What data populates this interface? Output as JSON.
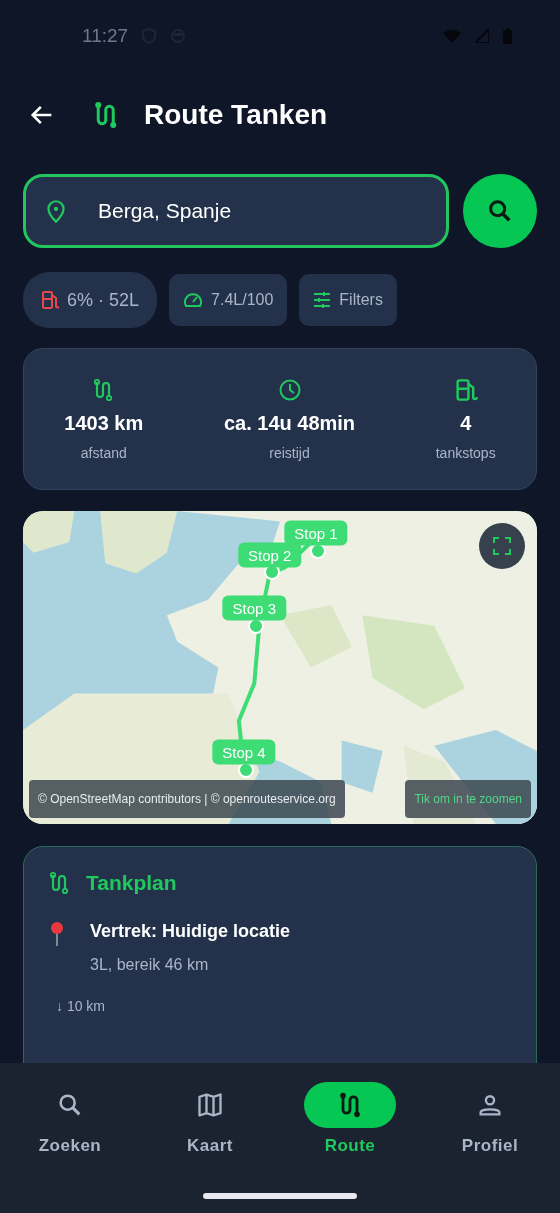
{
  "status_bar": {
    "time": "11:27"
  },
  "header": {
    "title": "Route Tanken"
  },
  "search": {
    "value": "Berga, Spanje"
  },
  "chips": [
    {
      "kind": "fuel",
      "label": "6% · 52L"
    },
    {
      "kind": "consumption",
      "label": "7.4L/100"
    },
    {
      "kind": "filters",
      "label": "Filters"
    }
  ],
  "stats": [
    {
      "kind": "distance",
      "value": "1403 km",
      "label": "afstand"
    },
    {
      "kind": "time",
      "value": "ca. 14u 48min",
      "label": "reistijd"
    },
    {
      "kind": "stops",
      "value": "4",
      "label": "tankstops"
    }
  ],
  "map": {
    "markers": [
      {
        "label": "Stop 1"
      },
      {
        "label": "Stop 2"
      },
      {
        "label": "Stop 3"
      },
      {
        "label": "Stop 4"
      }
    ],
    "attribution": "© OpenStreetMap contributors | © openrouteservice.org",
    "hint": "Tik om in te zoomen"
  },
  "tankplan": {
    "title": "Tankplan",
    "items": [
      {
        "title": "Vertrek: Huidige locatie",
        "detail": "3L, bereik 46 km"
      }
    ],
    "legs": [
      "↓ 10 km"
    ]
  },
  "nav": [
    {
      "kind": "search",
      "label": "Zoeken",
      "selected": false
    },
    {
      "kind": "map",
      "label": "Kaart",
      "selected": false
    },
    {
      "kind": "route",
      "label": "Route",
      "selected": true
    },
    {
      "kind": "profile",
      "label": "Profiel",
      "selected": false
    }
  ]
}
